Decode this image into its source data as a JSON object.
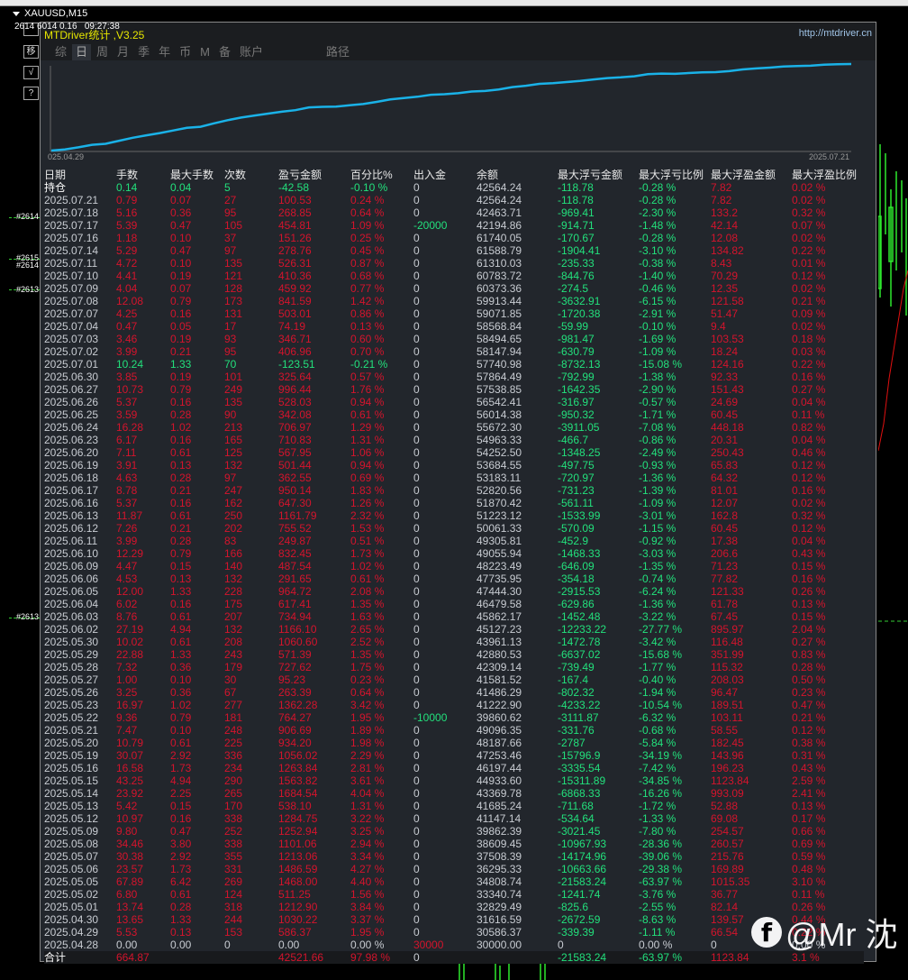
{
  "chart_window": {
    "symbol": "XAUUSD,M15",
    "ticker": "2614 6014 0.16   09:27:38",
    "side_buttons": [
      "移",
      "√",
      "?"
    ],
    "levels": [
      "#2614",
      "#2615",
      "#2614",
      "#2613",
      "#2613"
    ]
  },
  "panel": {
    "title": "MTDriver统计 ,V3.25",
    "url": "http://mtdriver.cn",
    "tabs": [
      "综",
      "日",
      "周",
      "月",
      "季",
      "年",
      "币",
      "M",
      "备",
      "账户",
      "路径"
    ],
    "active_tab": 1,
    "equity_chart": {
      "start_label": "025.04.29",
      "end_label": "2025.07.21"
    },
    "columns": [
      "日期",
      "手数",
      "最大手数",
      "次数",
      "盈亏金额",
      "百分比%",
      "出入金",
      "余额",
      "最大浮亏金额",
      "最大浮亏比例",
      "最大浮盈金额",
      "最大浮盈比例"
    ],
    "open_row": [
      "持仓",
      "0.14",
      "0.04",
      "5",
      "-42.58",
      "-0.10 %",
      "0",
      "42564.24",
      "-118.78",
      "-0.28 %",
      "7.82",
      "0.02 %"
    ],
    "rows": [
      [
        "2025.07.21",
        "0.79",
        "0.07",
        "27",
        "100.53",
        "0.24 %",
        "0",
        "42564.24",
        "-118.78",
        "-0.28 %",
        "7.82",
        "0.02 %"
      ],
      [
        "2025.07.18",
        "5.16",
        "0.36",
        "95",
        "268.85",
        "0.64 %",
        "0",
        "42463.71",
        "-969.41",
        "-2.30 %",
        "133.2",
        "0.32 %"
      ],
      [
        "2025.07.17",
        "5.39",
        "0.47",
        "105",
        "454.81",
        "1.09 %",
        "-20000",
        "42194.86",
        "-914.71",
        "-1.48 %",
        "42.14",
        "0.07 %"
      ],
      [
        "2025.07.16",
        "1.18",
        "0.10",
        "37",
        "151.26",
        "0.25 %",
        "0",
        "61740.05",
        "-170.67",
        "-0.28 %",
        "12.08",
        "0.02 %"
      ],
      [
        "2025.07.14",
        "5.29",
        "0.47",
        "97",
        "278.76",
        "0.45 %",
        "0",
        "61588.79",
        "-1904.41",
        "-3.10 %",
        "134.82",
        "0.22 %"
      ],
      [
        "2025.07.11",
        "4.72",
        "0.10",
        "135",
        "526.31",
        "0.87 %",
        "0",
        "61310.03",
        "-235.33",
        "-0.38 %",
        "8.43",
        "0.01 %"
      ],
      [
        "2025.07.10",
        "4.41",
        "0.19",
        "121",
        "410.36",
        "0.68 %",
        "0",
        "60783.72",
        "-844.76",
        "-1.40 %",
        "70.29",
        "0.12 %"
      ],
      [
        "2025.07.09",
        "4.04",
        "0.07",
        "128",
        "459.92",
        "0.77 %",
        "0",
        "60373.36",
        "-274.5",
        "-0.46 %",
        "12.35",
        "0.02 %"
      ],
      [
        "2025.07.08",
        "12.08",
        "0.79",
        "173",
        "841.59",
        "1.42 %",
        "0",
        "59913.44",
        "-3632.91",
        "-6.15 %",
        "121.58",
        "0.21 %"
      ],
      [
        "2025.07.07",
        "4.25",
        "0.16",
        "131",
        "503.01",
        "0.86 %",
        "0",
        "59071.85",
        "-1720.38",
        "-2.91 %",
        "51.47",
        "0.09 %"
      ],
      [
        "2025.07.04",
        "0.47",
        "0.05",
        "17",
        "74.19",
        "0.13 %",
        "0",
        "58568.84",
        "-59.99",
        "-0.10 %",
        "9.4",
        "0.02 %"
      ],
      [
        "2025.07.03",
        "3.46",
        "0.19",
        "93",
        "346.71",
        "0.60 %",
        "0",
        "58494.65",
        "-981.47",
        "-1.69 %",
        "103.53",
        "0.18 %"
      ],
      [
        "2025.07.02",
        "3.99",
        "0.21",
        "95",
        "406.96",
        "0.70 %",
        "0",
        "58147.94",
        "-630.79",
        "-1.09 %",
        "18.24",
        "0.03 %"
      ],
      [
        "2025.07.01",
        "10.24",
        "1.33",
        "70",
        "-123.51",
        "-0.21 %",
        "0",
        "57740.98",
        "-8732.13",
        "-15.08 %",
        "124.16",
        "0.22 %"
      ],
      [
        "2025.06.30",
        "3.85",
        "0.19",
        "101",
        "325.64",
        "0.57 %",
        "0",
        "57864.49",
        "-792.99",
        "-1.38 %",
        "92.33",
        "0.16 %"
      ],
      [
        "2025.06.27",
        "10.73",
        "0.79",
        "249",
        "996.44",
        "1.76 %",
        "0",
        "57538.85",
        "-1642.35",
        "-2.90 %",
        "151.43",
        "0.27 %"
      ],
      [
        "2025.06.26",
        "5.37",
        "0.16",
        "135",
        "528.03",
        "0.94 %",
        "0",
        "56542.41",
        "-316.97",
        "-0.57 %",
        "24.69",
        "0.04 %"
      ],
      [
        "2025.06.25",
        "3.59",
        "0.28",
        "90",
        "342.08",
        "0.61 %",
        "0",
        "56014.38",
        "-950.32",
        "-1.71 %",
        "60.45",
        "0.11 %"
      ],
      [
        "2025.06.24",
        "16.28",
        "1.02",
        "213",
        "706.97",
        "1.29 %",
        "0",
        "55672.30",
        "-3911.05",
        "-7.08 %",
        "448.18",
        "0.82 %"
      ],
      [
        "2025.06.23",
        "6.17",
        "0.16",
        "165",
        "710.83",
        "1.31 %",
        "0",
        "54963.33",
        "-466.7",
        "-0.86 %",
        "20.31",
        "0.04 %"
      ],
      [
        "2025.06.20",
        "7.11",
        "0.61",
        "125",
        "567.95",
        "1.06 %",
        "0",
        "54252.50",
        "-1348.25",
        "-2.49 %",
        "250.43",
        "0.46 %"
      ],
      [
        "2025.06.19",
        "3.91",
        "0.13",
        "132",
        "501.44",
        "0.94 %",
        "0",
        "53684.55",
        "-497.75",
        "-0.93 %",
        "65.83",
        "0.12 %"
      ],
      [
        "2025.06.18",
        "4.63",
        "0.28",
        "97",
        "362.55",
        "0.69 %",
        "0",
        "53183.11",
        "-720.97",
        "-1.36 %",
        "64.32",
        "0.12 %"
      ],
      [
        "2025.06.17",
        "8.78",
        "0.21",
        "247",
        "950.14",
        "1.83 %",
        "0",
        "52820.56",
        "-731.23",
        "-1.39 %",
        "81.01",
        "0.16 %"
      ],
      [
        "2025.06.16",
        "5.37",
        "0.16",
        "162",
        "647.30",
        "1.26 %",
        "0",
        "51870.42",
        "-561.11",
        "-1.09 %",
        "12.07",
        "0.02 %"
      ],
      [
        "2025.06.13",
        "11.87",
        "0.61",
        "250",
        "1161.79",
        "2.32 %",
        "0",
        "51223.12",
        "-1533.99",
        "-3.01 %",
        "162.8",
        "0.32 %"
      ],
      [
        "2025.06.12",
        "7.26",
        "0.21",
        "202",
        "755.52",
        "1.53 %",
        "0",
        "50061.33",
        "-570.09",
        "-1.15 %",
        "60.45",
        "0.12 %"
      ],
      [
        "2025.06.11",
        "3.99",
        "0.28",
        "83",
        "249.87",
        "0.51 %",
        "0",
        "49305.81",
        "-452.9",
        "-0.92 %",
        "17.38",
        "0.04 %"
      ],
      [
        "2025.06.10",
        "12.29",
        "0.79",
        "166",
        "832.45",
        "1.73 %",
        "0",
        "49055.94",
        "-1468.33",
        "-3.03 %",
        "206.6",
        "0.43 %"
      ],
      [
        "2025.06.09",
        "4.47",
        "0.15",
        "140",
        "487.54",
        "1.02 %",
        "0",
        "48223.49",
        "-646.09",
        "-1.35 %",
        "71.23",
        "0.15 %"
      ],
      [
        "2025.06.06",
        "4.53",
        "0.13",
        "132",
        "291.65",
        "0.61 %",
        "0",
        "47735.95",
        "-354.18",
        "-0.74 %",
        "77.82",
        "0.16 %"
      ],
      [
        "2025.06.05",
        "12.00",
        "1.33",
        "228",
        "964.72",
        "2.08 %",
        "0",
        "47444.30",
        "-2915.53",
        "-6.24 %",
        "121.33",
        "0.26 %"
      ],
      [
        "2025.06.04",
        "6.02",
        "0.16",
        "175",
        "617.41",
        "1.35 %",
        "0",
        "46479.58",
        "-629.86",
        "-1.36 %",
        "61.78",
        "0.13 %"
      ],
      [
        "2025.06.03",
        "8.76",
        "0.61",
        "207",
        "734.94",
        "1.63 %",
        "0",
        "45862.17",
        "-1452.48",
        "-3.22 %",
        "67.45",
        "0.15 %"
      ],
      [
        "2025.06.02",
        "27.19",
        "4.94",
        "132",
        "1166.10",
        "2.65 %",
        "0",
        "45127.23",
        "-12233.22",
        "-27.77 %",
        "895.97",
        "2.04 %"
      ],
      [
        "2025.05.30",
        "10.02",
        "0.61",
        "208",
        "1060.60",
        "2.52 %",
        "0",
        "43961.13",
        "-1472.78",
        "-3.42 %",
        "116.48",
        "0.27 %"
      ],
      [
        "2025.05.29",
        "22.88",
        "1.33",
        "243",
        "571.39",
        "1.35 %",
        "0",
        "42880.53",
        "-6637.02",
        "-15.68 %",
        "351.99",
        "0.83 %"
      ],
      [
        "2025.05.28",
        "7.32",
        "0.36",
        "179",
        "727.62",
        "1.75 %",
        "0",
        "42309.14",
        "-739.49",
        "-1.77 %",
        "115.32",
        "0.28 %"
      ],
      [
        "2025.05.27",
        "1.00",
        "0.10",
        "30",
        "95.23",
        "0.23 %",
        "0",
        "41581.52",
        "-167.4",
        "-0.40 %",
        "208.03",
        "0.50 %"
      ],
      [
        "2025.05.26",
        "3.25",
        "0.36",
        "67",
        "263.39",
        "0.64 %",
        "0",
        "41486.29",
        "-802.32",
        "-1.94 %",
        "96.47",
        "0.23 %"
      ],
      [
        "2025.05.23",
        "16.97",
        "1.02",
        "277",
        "1362.28",
        "3.42 %",
        "0",
        "41222.90",
        "-4233.22",
        "-10.54 %",
        "189.51",
        "0.47 %"
      ],
      [
        "2025.05.22",
        "9.36",
        "0.79",
        "181",
        "764.27",
        "1.95 %",
        "-10000",
        "39860.62",
        "-3111.87",
        "-6.32 %",
        "103.11",
        "0.21 %"
      ],
      [
        "2025.05.21",
        "7.47",
        "0.10",
        "248",
        "906.69",
        "1.89 %",
        "0",
        "49096.35",
        "-331.76",
        "-0.68 %",
        "58.55",
        "0.12 %"
      ],
      [
        "2025.05.20",
        "10.79",
        "0.61",
        "225",
        "934.20",
        "1.98 %",
        "0",
        "48187.66",
        "-2787",
        "-5.84 %",
        "182.45",
        "0.38 %"
      ],
      [
        "2025.05.19",
        "30.07",
        "2.92",
        "336",
        "1056.02",
        "2.29 %",
        "0",
        "47253.46",
        "-15796.9",
        "-34.19 %",
        "143.96",
        "0.31 %"
      ],
      [
        "2025.05.16",
        "16.58",
        "1.73",
        "234",
        "1263.84",
        "2.81 %",
        "0",
        "46197.44",
        "-3335.54",
        "-7.42 %",
        "196.23",
        "0.43 %"
      ],
      [
        "2025.05.15",
        "43.25",
        "4.94",
        "290",
        "1563.82",
        "3.61 %",
        "0",
        "44933.60",
        "-15311.89",
        "-34.85 %",
        "1123.84",
        "2.59 %"
      ],
      [
        "2025.05.14",
        "23.92",
        "2.25",
        "265",
        "1684.54",
        "4.04 %",
        "0",
        "43369.78",
        "-6868.33",
        "-16.26 %",
        "993.09",
        "2.41 %"
      ],
      [
        "2025.05.13",
        "5.42",
        "0.15",
        "170",
        "538.10",
        "1.31 %",
        "0",
        "41685.24",
        "-711.68",
        "-1.72 %",
        "52.88",
        "0.13 %"
      ],
      [
        "2025.05.12",
        "10.97",
        "0.16",
        "338",
        "1284.75",
        "3.22 %",
        "0",
        "41147.14",
        "-534.64",
        "-1.33 %",
        "69.08",
        "0.17 %"
      ],
      [
        "2025.05.09",
        "9.80",
        "0.47",
        "252",
        "1252.94",
        "3.25 %",
        "0",
        "39862.39",
        "-3021.45",
        "-7.80 %",
        "254.57",
        "0.66 %"
      ],
      [
        "2025.05.08",
        "34.46",
        "3.80",
        "338",
        "1101.06",
        "2.94 %",
        "0",
        "38609.45",
        "-10967.93",
        "-28.36 %",
        "260.57",
        "0.69 %"
      ],
      [
        "2025.05.07",
        "30.38",
        "2.92",
        "355",
        "1213.06",
        "3.34 %",
        "0",
        "37508.39",
        "-14174.96",
        "-39.06 %",
        "215.76",
        "0.59 %"
      ],
      [
        "2025.05.06",
        "23.57",
        "1.73",
        "331",
        "1486.59",
        "4.27 %",
        "0",
        "36295.33",
        "-10663.66",
        "-29.38 %",
        "169.89",
        "0.48 %"
      ],
      [
        "2025.05.05",
        "67.89",
        "6.42",
        "269",
        "1468.00",
        "4.40 %",
        "0",
        "34808.74",
        "-21583.24",
        "-63.97 %",
        "1015.35",
        "3.10 %"
      ],
      [
        "2025.05.02",
        "6.80",
        "0.61",
        "124",
        "511.25",
        "1.56 %",
        "0",
        "33340.74",
        "-1241.74",
        "-3.76 %",
        "36.77",
        "0.11 %"
      ],
      [
        "2025.05.01",
        "13.74",
        "0.28",
        "318",
        "1212.90",
        "3.84 %",
        "0",
        "32829.49",
        "-825.6",
        "-2.55 %",
        "82.14",
        "0.26 %"
      ],
      [
        "2025.04.30",
        "13.65",
        "1.33",
        "244",
        "1030.22",
        "3.37 %",
        "0",
        "31616.59",
        "-2672.59",
        "-8.63 %",
        "139.57",
        "0.44 %"
      ],
      [
        "2025.04.29",
        "5.53",
        "0.13",
        "153",
        "586.37",
        "1.95 %",
        "0",
        "30586.37",
        "-339.39",
        "-1.11 %",
        "66.54",
        "0.22 %"
      ],
      [
        "2025.04.28",
        "0.00",
        "0.00",
        "0",
        "0.00",
        "0.00 %",
        "30000",
        "30000.00",
        "0",
        "0.00 %",
        "0",
        "0.00 %"
      ]
    ],
    "total_row": [
      "合计",
      "664.87",
      "",
      "",
      "42521.66",
      "97.98 %",
      "0",
      "",
      "-21583.24",
      "-63.97 %",
      "1123.84",
      "3.1 %"
    ]
  },
  "watermark": {
    "icon": "facebook-icon",
    "text": "@Mr 沈"
  },
  "colors": {
    "profit": "#d4142c",
    "loss": "#22e07c",
    "neutral": "#c8ccd2",
    "equity_line": "#1ab2e8"
  }
}
